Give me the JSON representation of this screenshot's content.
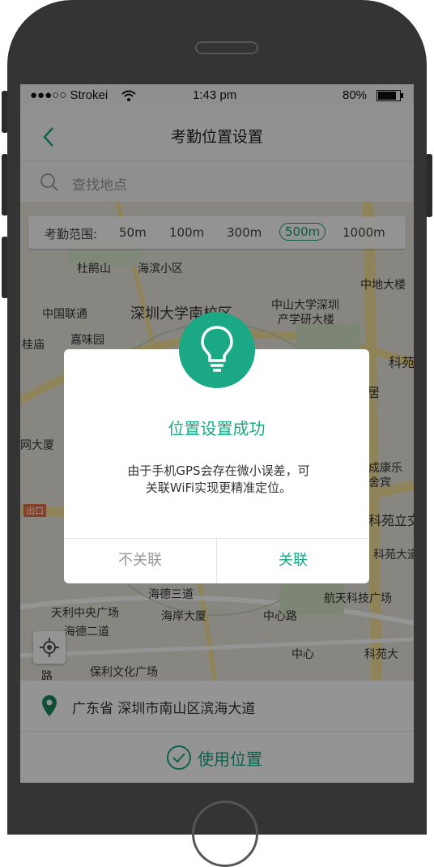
{
  "status_bar": {
    "carrier": "●●●○○ Strokei",
    "time": "1:43 pm",
    "battery": "80%"
  },
  "nav": {
    "title": "考勤位置设置"
  },
  "search": {
    "placeholder": "查找地点"
  },
  "range": {
    "label": "考勤范围:",
    "options": [
      "50m",
      "100m",
      "300m",
      "500m",
      "1000m"
    ],
    "selected": "500m"
  },
  "map": {
    "labels": [
      "杜鹃山",
      "海滨小区",
      "深圳大学南校区",
      "中山大学深圳",
      "产学研大楼",
      "中国联通",
      "中地大楼",
      "嘉味园",
      "科苑",
      "桂庙",
      "网大厦",
      "出口",
      "海德三道",
      "海德二道",
      "天利中央广场",
      "海岸大厦",
      "航天科技广场",
      "保利文化广场",
      "中心路",
      "科苑大",
      "中心",
      "路",
      "居",
      "成康乐",
      "舍宾",
      "科苑立交",
      "科苑大道"
    ]
  },
  "dialog": {
    "title": "位置设置成功",
    "message": "由于手机GPS会存在微小误差，可关联WiFi实现更精准定位。",
    "cancel": "不关联",
    "confirm": "关联"
  },
  "address": {
    "text": "广东省 深圳市南山区滨海大道"
  },
  "use_location": {
    "label": "使用位置"
  },
  "colors": {
    "accent": "#1aa885",
    "range_selected": "#1a9c7a"
  }
}
